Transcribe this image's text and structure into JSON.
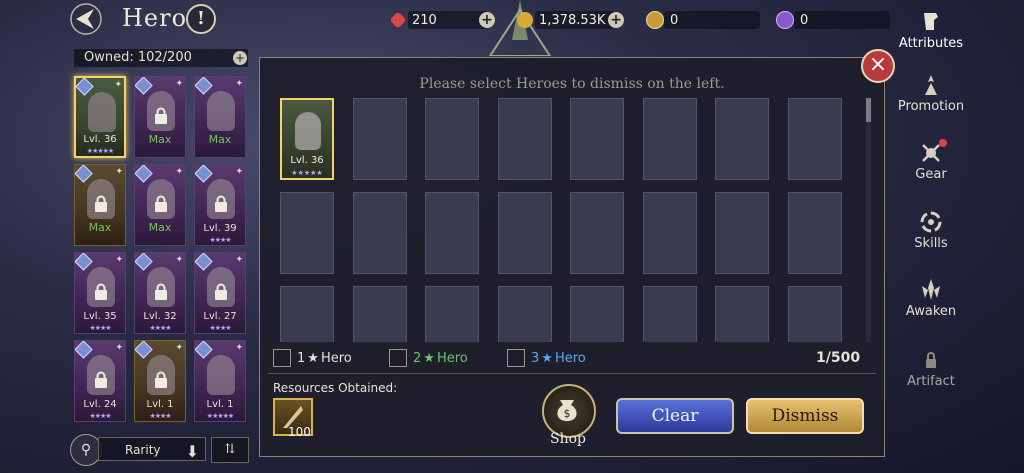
{
  "header": {
    "title": "Hero",
    "info_label": "!"
  },
  "resources": [
    {
      "name": "red-gem",
      "value": "210",
      "color": "#d84848",
      "has_plus": true
    },
    {
      "name": "gold-coin",
      "value": "1,378.53K",
      "color": "#d9a83a",
      "has_plus": true
    },
    {
      "name": "gold-token",
      "value": "0",
      "color": "#c99a3a",
      "has_plus": false
    },
    {
      "name": "purple-token",
      "value": "0",
      "color": "#8a58c8",
      "has_plus": false
    }
  ],
  "left_panel": {
    "owned_label": "Owned: 102/200",
    "heroes": [
      {
        "level": "Lvl. 36",
        "max": false,
        "locked": false,
        "selected": true,
        "stars": "★★★★★"
      },
      {
        "level": "Max",
        "max": true,
        "locked": true,
        "selected": false,
        "stars": ""
      },
      {
        "level": "Max",
        "max": true,
        "locked": false,
        "selected": false,
        "stars": ""
      },
      {
        "level": "Max",
        "max": true,
        "locked": true,
        "selected": false,
        "stars": "",
        "gold": true
      },
      {
        "level": "Max",
        "max": true,
        "locked": true,
        "selected": false,
        "stars": ""
      },
      {
        "level": "Lvl. 39",
        "max": false,
        "locked": true,
        "selected": false,
        "stars": "★★★★"
      },
      {
        "level": "Lvl. 35",
        "max": false,
        "locked": true,
        "selected": false,
        "stars": "★★★★"
      },
      {
        "level": "Lvl. 32",
        "max": false,
        "locked": true,
        "selected": false,
        "stars": "★★★★"
      },
      {
        "level": "Lvl. 27",
        "max": false,
        "locked": true,
        "selected": false,
        "stars": "★★★★"
      },
      {
        "level": "Lvl. 24",
        "max": false,
        "locked": true,
        "selected": false,
        "stars": "★★★★"
      },
      {
        "level": "Lvl. 1",
        "max": false,
        "locked": true,
        "selected": false,
        "stars": "★★★★",
        "gold": true
      },
      {
        "level": "Lvl. 1",
        "max": false,
        "locked": false,
        "selected": false,
        "stars": "★★★★★"
      }
    ],
    "sort_label": "Rarity"
  },
  "dialog": {
    "hint": "Please select Heroes to dismiss on the left.",
    "selected_hero_level": "Lvl. 36",
    "selected_hero_stars": "★★★★★",
    "slot_count": 24,
    "filters": [
      {
        "num": "1",
        "label": "Hero",
        "star_color": "#e6e2d6",
        "text_color": "#e6e2d6"
      },
      {
        "num": "2",
        "label": "Hero",
        "star_color": "#6cc46a",
        "text_color": "#6cc46a"
      },
      {
        "num": "3",
        "label": "Hero",
        "star_color": "#5aa8e8",
        "text_color": "#5aa8e8"
      }
    ],
    "count": "1/500",
    "resources_title": "Resources Obtained:",
    "resource_qty": "100",
    "shop_label": "Shop",
    "clear_label": "Clear",
    "dismiss_label": "Dismiss"
  },
  "nav": [
    {
      "label": "Attributes",
      "icon": "attributes-icon",
      "active": true
    },
    {
      "label": "Promotion",
      "icon": "promotion-icon"
    },
    {
      "label": "Gear",
      "icon": "gear-icon",
      "dot": true
    },
    {
      "label": "Skills",
      "icon": "skills-icon"
    },
    {
      "label": "Awaken",
      "icon": "awaken-icon"
    },
    {
      "label": "Artifact",
      "icon": "artifact-icon"
    }
  ]
}
